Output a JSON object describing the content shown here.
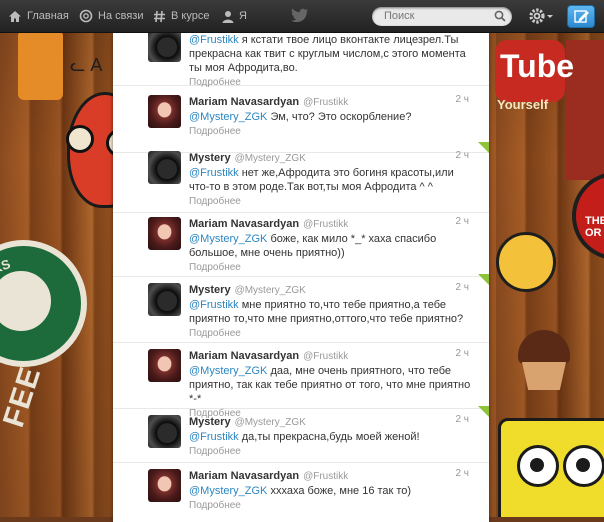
{
  "nav": {
    "home_label": "Главная",
    "connect_label": "На связи",
    "discover_label": "В курсе",
    "me_label": "Я"
  },
  "search": {
    "placeholder": "Поиск"
  },
  "colors": {
    "mention": "#2c86c1",
    "topbar": "#2a2a2a",
    "compose": "#2b89cf",
    "retweet_corner": "#8fc33a"
  },
  "background": {
    "yt_text": "Tube",
    "yt_tagline": "Yourself",
    "starbucks_text": "UCKS",
    "coffee_text": "FEE",
    "circle_text": "THE\nOR"
  },
  "tweets": [
    {
      "author": "",
      "handle": "",
      "time": "",
      "mention": "@Frustikk",
      "text": " я кстати твое лицо вконтакте лицезрел.Ты прекрасна как твит с круглым числом,с этого момента ты моя Афродита,во.",
      "more": "Подробнее",
      "avatar": "mystery-avatar",
      "highlighted": false
    },
    {
      "author": "Mariam Navasardyan",
      "handle": "@Frustikk",
      "time": "2 ч",
      "mention": "@Mystery_ZGK",
      "text": " Эм, что? Это оскорбление?",
      "more": "Подробнее",
      "avatar": "mariam-avatar",
      "highlighted": false
    },
    {
      "author": "Mystery",
      "handle": "@Mystery_ZGK",
      "time": "2 ч",
      "mention": "@Frustikk",
      "text": " нет же,Афродита это богиня красоты,или что-то в этом роде.Так вот,ты моя Афродита ^ ^",
      "more": "Подробнее",
      "avatar": "mystery-avatar",
      "highlighted": true
    },
    {
      "author": "Mariam Navasardyan",
      "handle": "@Frustikk",
      "time": "2 ч",
      "mention": "@Mystery_ZGK",
      "text": " боже, как мило *_* хаха спасибо большое, мне очень приятно))",
      "more": "Подробнее",
      "avatar": "mariam-avatar",
      "highlighted": false
    },
    {
      "author": "Mystery",
      "handle": "@Mystery_ZGK",
      "time": "2 ч",
      "mention": "@Frustikk",
      "text": " мне приятно то,что тебе приятно,а тебе приятно то,что мне приятно,оттого,что тебе приятно?",
      "more": "Подробнее",
      "avatar": "mystery-avatar",
      "highlighted": true
    },
    {
      "author": "Mariam Navasardyan",
      "handle": "@Frustikk",
      "time": "2 ч",
      "mention": "@Mystery_ZGK",
      "text": " даа, мне очень приятного, что тебе приятно, так как тебе приятно от того, что мне приятно *-*",
      "more": "Подробнее",
      "avatar": "mariam-avatar",
      "highlighted": false
    },
    {
      "author": "Mystery",
      "handle": "@Mystery_ZGK",
      "time": "2 ч",
      "mention": "@Frustikk",
      "text": " да,ты прекрасна,будь моей женой!",
      "more": "Подробнее",
      "avatar": "mystery-avatar",
      "highlighted": true
    },
    {
      "author": "Mariam Navasardyan",
      "handle": "@Frustikk",
      "time": "2 ч",
      "mention": "@Mystery_ZGK",
      "text": " хххаха боже, мне 16 так то)",
      "more": "Подробнее",
      "avatar": "mariam-avatar",
      "highlighted": false
    }
  ]
}
